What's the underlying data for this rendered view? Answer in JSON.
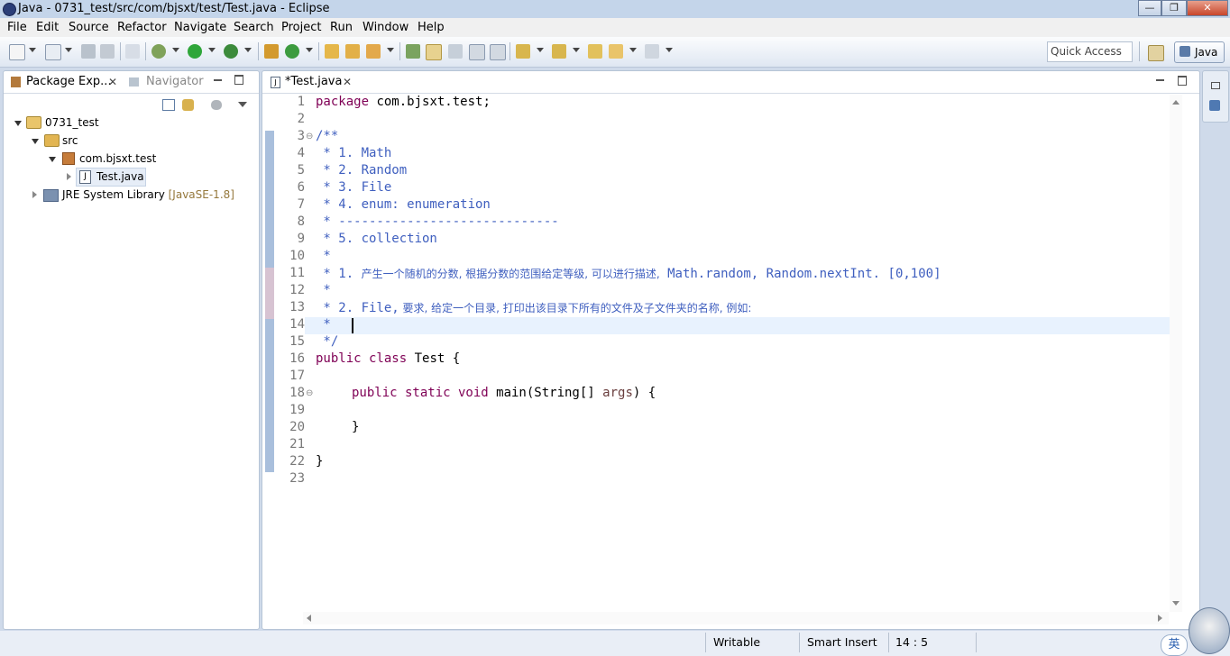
{
  "window": {
    "title": "Java - 0731_test/src/com/bjsxt/test/Test.java - Eclipse"
  },
  "menu": [
    "File",
    "Edit",
    "Source",
    "Refactor",
    "Navigate",
    "Search",
    "Project",
    "Run",
    "Window",
    "Help"
  ],
  "toolbar": {
    "quick_access": "Quick Access",
    "perspective": "Java"
  },
  "left_panel": {
    "tabs": {
      "package_explorer": "Package Exp...",
      "navigator": "Navigator"
    },
    "tree": {
      "project": "0731_test",
      "src": "src",
      "package": "com.bjsxt.test",
      "file": "Test.java",
      "jre": "JRE System Library",
      "jre_version": "[JavaSE-1.8]"
    }
  },
  "editor": {
    "tab": "*Test.java",
    "line_numbers": [
      "1",
      "2",
      "3",
      "4",
      "5",
      "6",
      "7",
      "8",
      "9",
      "10",
      "11",
      "12",
      "13",
      "14",
      "15",
      "16",
      "17",
      "18",
      "19",
      "20",
      "21",
      "22",
      "23"
    ],
    "cursor_line": 14,
    "lines": {
      "l1_kw": "package",
      "l1_rest": " com.bjsxt.test;",
      "l3": "/**",
      "l4": " * 1. Math",
      "l5": " * 2. Random",
      "l6": " * 3. File",
      "l7": " * 4. enum: enumeration",
      "l8": " * -----------------------------",
      "l9": " * 5. collection",
      "l10": " *",
      "l11_a": " * 1. ",
      "l11_cn": "产生一个随机的分数, 根据分数的范围给定等级, 可以进行描述,",
      "l11_b": " Math.random, Random.nextInt. [0,100]",
      "l12": " *",
      "l13_a": " * 2. File,",
      "l13_cn": " 要求, 给定一个目录, 打印出该目录下所有的文件及子文件夹的名称, 例如:",
      "l14": " *",
      "l15": " */",
      "l16_kw": "public class",
      "l16_rest": " Test {",
      "l18_kw": "public static void",
      "l18_rest": " main(String[] ",
      "l18_param": "args",
      "l18_end": ") {",
      "l20": "}",
      "l22": "}"
    }
  },
  "statusbar": {
    "writable": "Writable",
    "insert_mode": "Smart Insert",
    "position": "14 : 5"
  },
  "ime": {
    "label": "英"
  },
  "colors": {
    "keyword": "#7f0055",
    "comment": "#3f5fbf",
    "highlight_line": "#e8f2fe"
  }
}
